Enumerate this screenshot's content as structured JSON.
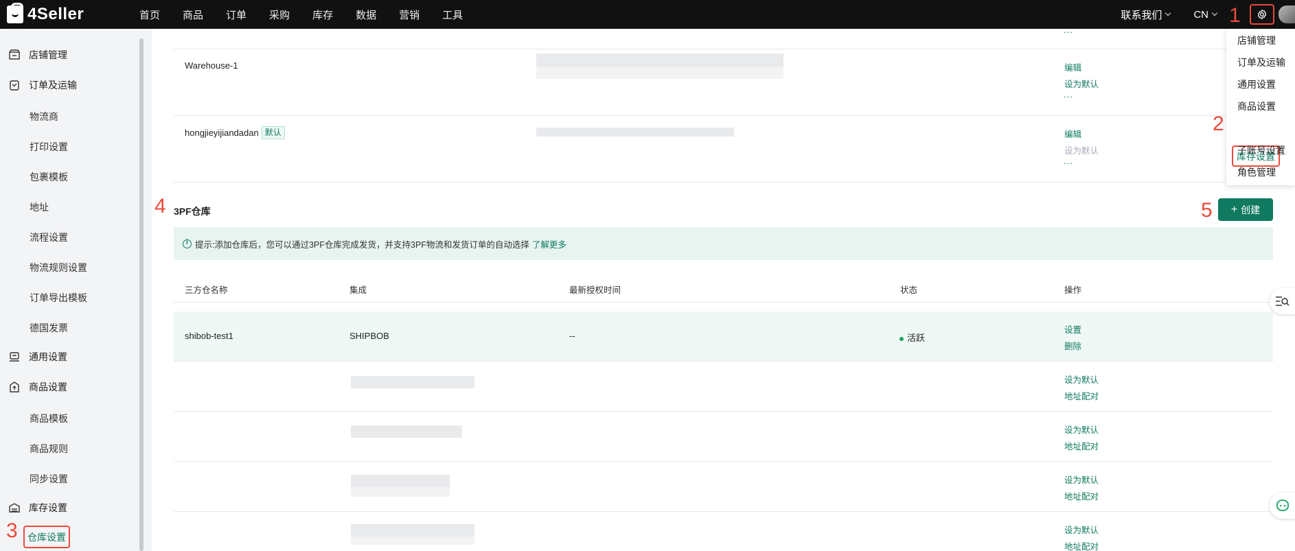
{
  "brand": {
    "name": "4Seller"
  },
  "nav": [
    "首页",
    "商品",
    "订单",
    "采购",
    "库存",
    "数据",
    "营销",
    "工具"
  ],
  "header": {
    "contact": "联系我们",
    "lang": "CN"
  },
  "sidebar": {
    "store": "店铺管理",
    "orders": "订单及运输",
    "order_subs": [
      "物流商",
      "打印设置",
      "包裹模板",
      "地址",
      "流程设置",
      "物流规则设置",
      "订单导出模板",
      "德国发票"
    ],
    "general": "通用设置",
    "product": "商品设置",
    "product_subs": [
      "商品模板",
      "商品规则",
      "同步设置"
    ],
    "inventory": "库存设置",
    "warehouse": "仓库设置"
  },
  "dropdown": [
    "店铺管理",
    "订单及运输",
    "通用设置",
    "商品设置",
    "库存设置",
    "子账号设置",
    "角色管理"
  ],
  "warehouses": {
    "top_dots": "...",
    "rows": [
      {
        "name": "Warehouse-1",
        "edit": "编辑",
        "set_default": "设为默认",
        "more": "..."
      },
      {
        "name": "hongjieyijiandadan",
        "tag": "默认",
        "edit": "编辑",
        "set_default": "设为默认",
        "more": "..."
      }
    ]
  },
  "tpf": {
    "title": "3PF仓库",
    "create": "创建",
    "tip": "提示:添加仓库后，您可以通过3PF仓库完成发货，并支持3PF物流和发货订单的自动选择",
    "tip_link": "了解更多",
    "headers": [
      "三方仓名称",
      "集成",
      "最新授权时间",
      "状态",
      "操作"
    ],
    "row": {
      "name": "shibob-test1",
      "integration": "SHIPBOB",
      "auth_time": "--",
      "status": "活跃",
      "settings": "设置",
      "delete": "删除"
    },
    "sub_actions": {
      "set_default": "设为默认",
      "address_match": "地址配对"
    }
  },
  "annotations": [
    "1",
    "2",
    "3",
    "4",
    "5"
  ],
  "colors": {
    "accent": "#0f7a5f",
    "highlight": "#e84a3a",
    "topbar": "#111111"
  }
}
